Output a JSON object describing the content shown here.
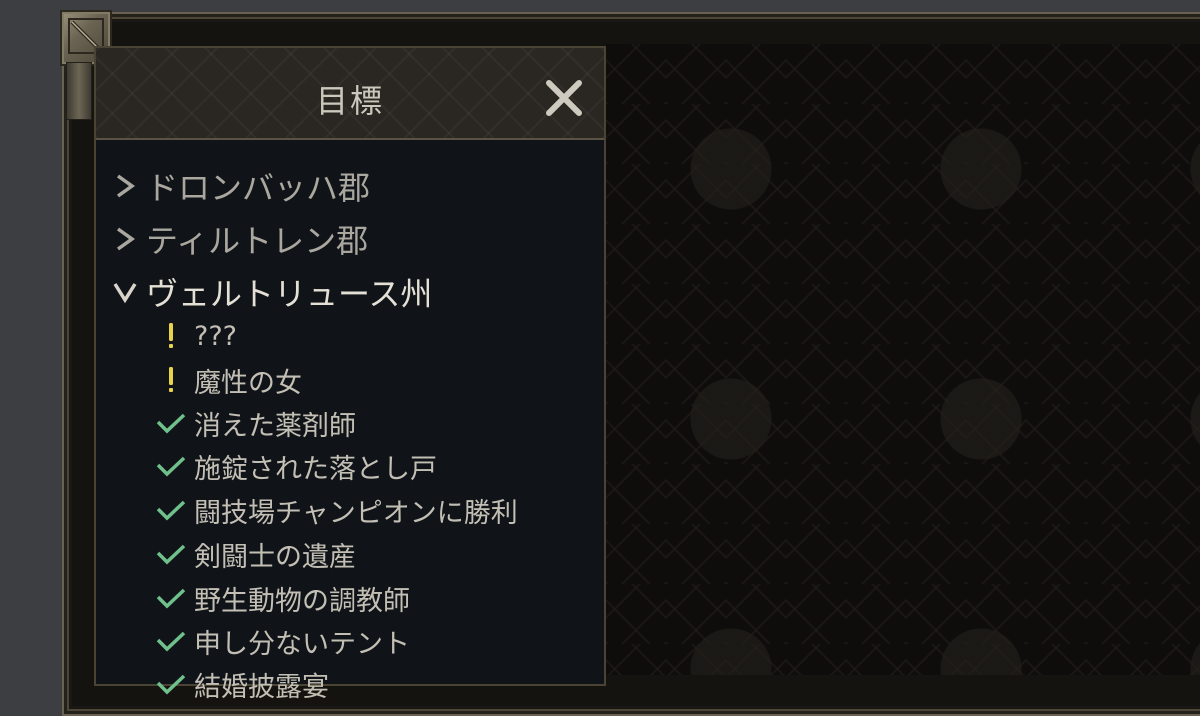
{
  "panel": {
    "title": "目標"
  },
  "regions": [
    {
      "label": "ドロンバッハ郡",
      "state": "collapsed"
    },
    {
      "label": "ティルトレン郡",
      "state": "collapsed"
    },
    {
      "label": "ヴェルトリュース州",
      "state": "expanded"
    }
  ],
  "quests": [
    {
      "label": "???",
      "status": "active"
    },
    {
      "label": "魔性の女",
      "status": "active"
    },
    {
      "label": "消えた薬剤師",
      "status": "completed"
    },
    {
      "label": "施錠された落とし戸",
      "status": "completed"
    },
    {
      "label": "闘技場チャンピオンに勝利",
      "status": "completed"
    },
    {
      "label": "剣闘士の遺産",
      "status": "completed"
    },
    {
      "label": "野生動物の調教師",
      "status": "completed"
    },
    {
      "label": "申し分ないテント",
      "status": "completed"
    },
    {
      "label": "結婚披露宴",
      "status": "completed"
    }
  ],
  "colors": {
    "active": "#e8d24a",
    "completed": "#6fc08a",
    "chevron": "#aaa79f"
  },
  "icons": {
    "collapsed": "chevron-right-icon",
    "expanded": "chevron-down-icon",
    "active": "exclamation-icon",
    "completed": "checkmark-icon",
    "close": "close-icon"
  }
}
